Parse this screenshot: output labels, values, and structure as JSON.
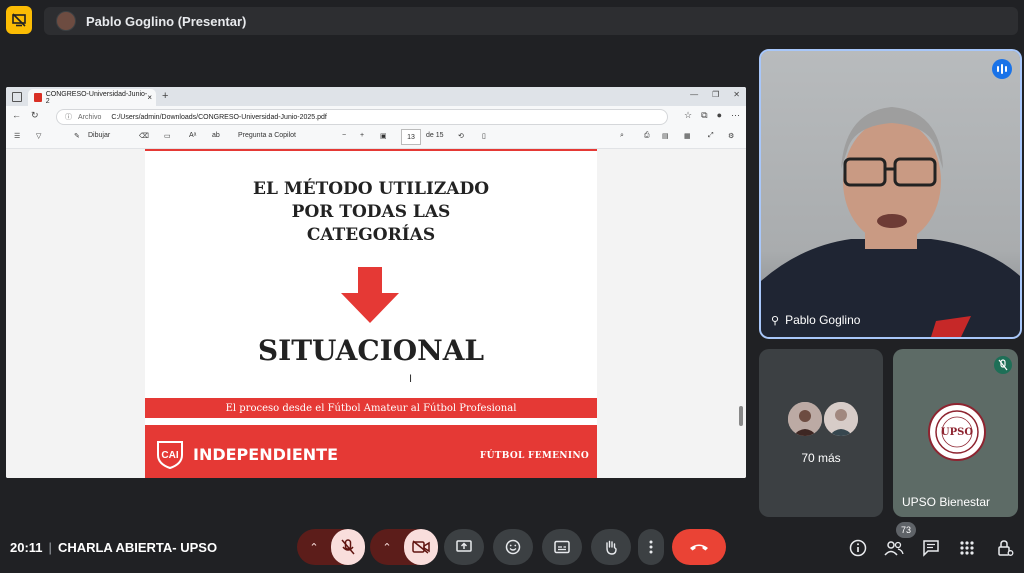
{
  "presenting": {
    "presenter_label": "Pablo Goglino (Presentar)"
  },
  "browser": {
    "tab_title": "CONGRESO-Universidad-Junio-2",
    "address_prefix": "Archivo",
    "url": "C:/Users/admin/Downloads/CONGRESO-Universidad-Junio-2025.pdf"
  },
  "pdf_toolbar": {
    "draw_label": "Dibujar",
    "copilot_label": "Pregunta a Copilot",
    "page_current": "13",
    "page_total": "de 15"
  },
  "slide": {
    "title_lines": [
      "EL MÉTODO UTILIZADO",
      "POR TODAS LAS",
      "CATEGORÍAS"
    ],
    "main": "SITUACIONAL",
    "band": "El proceso desde el Fútbol Amateur al Fútbol Profesional",
    "brand": "INDEPENDIENTE",
    "category": "FÚTBOL FEMENINO",
    "accent": "#e53935"
  },
  "participants": {
    "main_name": "Pablo Goglino",
    "more_label": "70 más",
    "upso_name": "UPSO Bienestar",
    "upso_logo_text": "UPSO"
  },
  "meeting": {
    "time": "20:11",
    "title": "CHARLA ABIERTA- UPSO",
    "people_count": "73"
  }
}
